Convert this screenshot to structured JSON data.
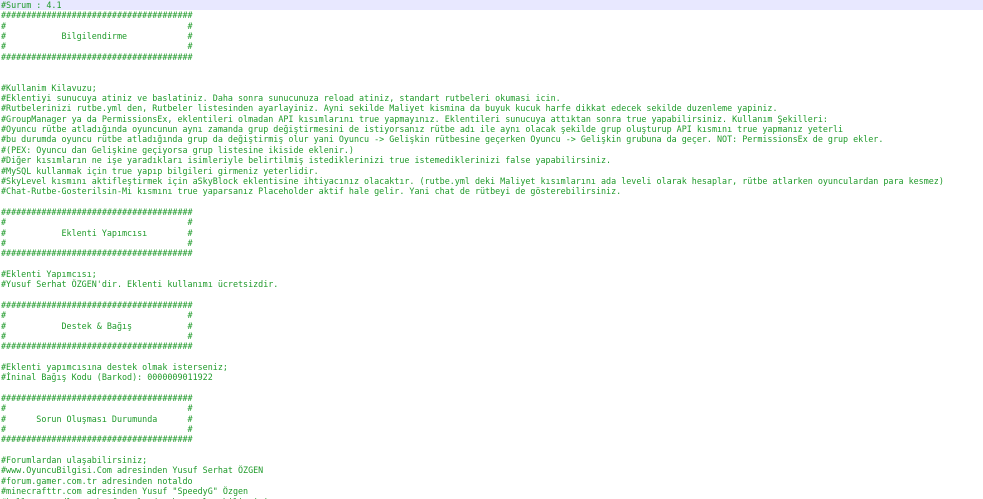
{
  "editor": {
    "current_line_bg": "#e8e8ff",
    "text_color": "#1f9a2a",
    "lines": [
      "#Surum : 4.1",
      "######################################",
      "#                                    #",
      "#           Bilgilendirme            #",
      "#                                    #",
      "######################################",
      "",
      "",
      "#Kullanim Kilavuzu;",
      "#Eklentiyi sunucuya atiniz ve baslatiniz. Daha sonra sunucunuza reload atiniz, standart rutbeleri okumasi icin.",
      "#Rutbelerinizi rutbe.yml den, Rutbeler listesinden ayarlayiniz. Ayni sekilde Maliyet kismina da buyuk kucuk harfe dikkat edecek sekilde duzenleme yapiniz.",
      "#GroupManager ya da PermissionsEx, eklentileri olmadan API kısımlarını true yapmayınız. Eklentileri sunucuya attıktan sonra true yapabilirsiniz. Kullanım Şekilleri:",
      "#Oyuncu rütbe atladığında oyuncunun aynı zamanda grup değiştirmesini de istiyorsanız rütbe adı ile aynı olacak şekilde grup oluşturup API kısmını true yapmanız yeterli",
      "#bu durumda oyuncu rütbe atladığında grup da değiştirmiş olur yani Oyuncu -> Gelişkin rütbesine geçerken Oyuncu -> Gelişkin grubuna da geçer. NOT: PermissionsEx de grup ekler.",
      "#(PEX: Oyuncu dan Gelişkine geçiyorsa grup listesine ikiside eklenir.)",
      "#Diğer kısımların ne işe yaradıkları isimleriyle belirtilmiş istediklerinizi true istemediklerinizi false yapabilirsiniz.",
      "#MySQL kullanmak için true yapıp bilgileri girmeniz yeterlidir.",
      "#SkyLevel kısmını aktifleştirmek için aSkyBlock eklentisine ihtiyacınız olacaktır. (rutbe.yml deki Maliyet kısımlarını ada leveli olarak hesaplar, rütbe atlarken oyunculardan para kesmez)",
      "#Chat-Rutbe-Gosterilsin-Mi kısmını true yaparsanız Placeholder aktif hale gelir. Yani chat de rütbeyi de gösterebilirsiniz.",
      "",
      "######################################",
      "#                                    #",
      "#           Eklenti Yapımcısı        #",
      "#                                    #",
      "######################################",
      "",
      "#Eklenti Yapımcısı;",
      "#Yusuf Serhat ÖZGEN'dir. Eklenti kullanımı ücretsizdir.",
      "",
      "######################################",
      "#                                    #",
      "#           Destek & Bağış           #",
      "#                                    #",
      "######################################",
      "",
      "#Eklenti yapımcısına destek olmak isterseniz;",
      "#İninal Bağış Kodu (Barkod): 0000009011922",
      "",
      "######################################",
      "#                                    #",
      "#      Sorun Oluşması Durumunda      #",
      "#                                    #",
      "######################################",
      "",
      "#Forumlardan ulaşabilirsiniz;",
      "#www.OyuncuBilgisi.Com adresinden Yusuf Serhat ÖZGEN",
      "#forum.gamer.com.tr adresinden notaldo",
      "#minecrafttr.com adresinden Yusuf \"SpeedyG\" Özgen",
      "#kullanıcı adlarım bu forumlardan bana ulaşabilirsiniz."
    ]
  }
}
